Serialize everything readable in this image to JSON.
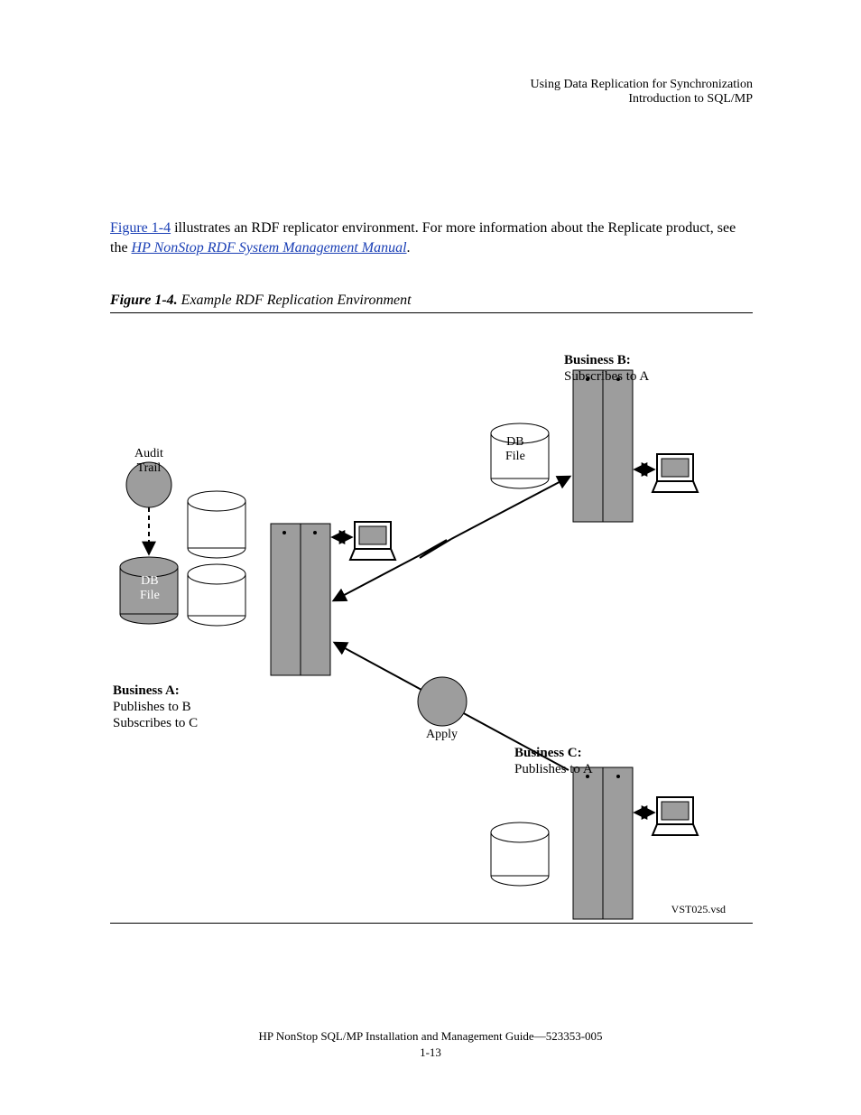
{
  "header": {
    "line1": "Using Data Replication for Synchronization",
    "line2": "Introduction to SQL/MP"
  },
  "body": {
    "p1_link_text": "Figure 1-4",
    "p1_after_link": " illustrates an RDF replicator environment.  For more information about the Replicate product, see the ",
    "p1_link2_text": "HP NonStop RDF System Management Manual",
    "p1_after_link2": "."
  },
  "figure": {
    "number": "Figure 1-4.",
    "title": "Example RDF Replication Environment",
    "label_audit": "Audit",
    "label_trail": "Trail",
    "label_db": "DB",
    "label_file": "File",
    "label_db2": "DB",
    "label_file2": "File",
    "label_business_a": "Business A:",
    "label_a_details1": "Publishes to B",
    "label_a_details2": "Subscribes to C",
    "label_business_b": "Business B:",
    "label_b_details": "Subscribes to A",
    "label_business_c": "Business C:",
    "label_c_details": "Publishes to A",
    "label_apply": "Apply",
    "footnote": "VST025.vsd"
  },
  "footer": {
    "doc_ref": "HP NonStop SQL/MP Installation and Management Guide",
    "doc_id": "523353-005",
    "page": "1-13"
  }
}
